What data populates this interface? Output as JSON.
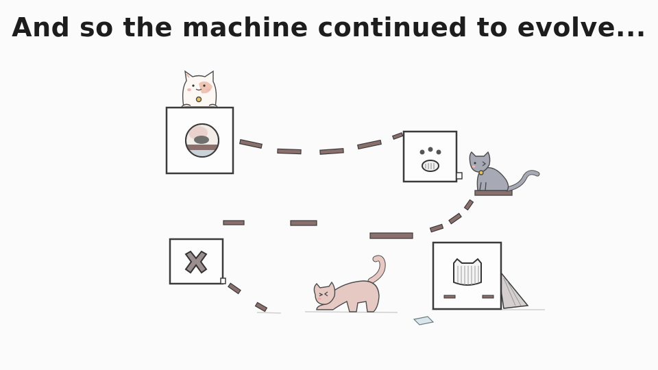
{
  "slide": {
    "title": "And so the machine continued to evolve..."
  },
  "palette": {
    "background": "#fbfbfb",
    "box_stroke": "#3a3a3a",
    "plank": "#8a6f6d",
    "cat_pink": "#e7c9c4",
    "cat_gray": "#a7aab5",
    "cat_white": "#fdf8f4"
  },
  "icons": [
    "calico-cat",
    "gray-cat",
    "pink-cat",
    "porthole-box",
    "paw-box",
    "x-box",
    "cat-face-box"
  ]
}
